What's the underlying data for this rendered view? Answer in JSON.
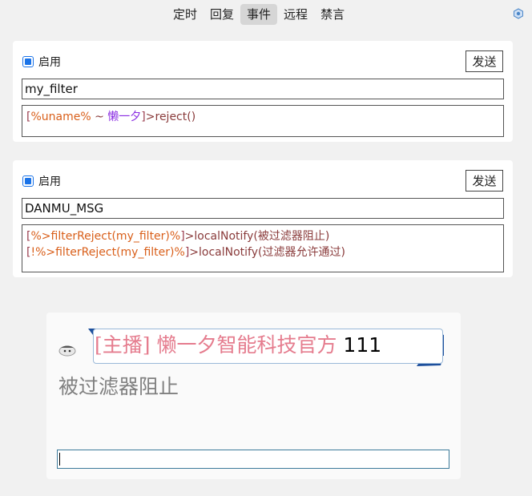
{
  "tabs": [
    {
      "label": "定时",
      "active": false
    },
    {
      "label": "回复",
      "active": false
    },
    {
      "label": "事件",
      "active": true
    },
    {
      "label": "远程",
      "active": false
    },
    {
      "label": "禁言",
      "active": false
    }
  ],
  "rules": [
    {
      "enabled": true,
      "enable_label": "启用",
      "send_label": "发送",
      "name": "my_filter",
      "code_lines": [
        [
          {
            "t": "[",
            "c": "brack"
          },
          {
            "t": "%uname%",
            "c": "orange"
          },
          {
            "t": " ~ ",
            "c": "plain"
          },
          {
            "t": "懒一夕",
            "c": "purple"
          },
          {
            "t": "]",
            "c": "brack"
          },
          {
            "t": ">reject()",
            "c": "plain"
          }
        ]
      ]
    },
    {
      "enabled": true,
      "enable_label": "启用",
      "send_label": "发送",
      "name": "DANMU_MSG",
      "code_lines": [
        [
          {
            "t": "[",
            "c": "brack"
          },
          {
            "t": "%>filterReject(my_filter)%",
            "c": "orange"
          },
          {
            "t": "]",
            "c": "brack"
          },
          {
            "t": ">localNotify(被过滤器阻止)",
            "c": "plain"
          }
        ],
        [
          {
            "t": "[",
            "c": "brack"
          },
          {
            "t": "!%>filterReject(my_filter)%",
            "c": "orange"
          },
          {
            "t": "]",
            "c": "brack"
          },
          {
            "t": ">localNotify(过滤器允许通过)",
            "c": "plain"
          }
        ]
      ]
    }
  ],
  "preview": {
    "danmu_name": "[主播] 懒一夕智能科技官方",
    "danmu_msg": "111",
    "result": "被过滤器阻止",
    "input_value": ""
  },
  "colors": {
    "accent": "#1a73e8",
    "orange": "#d95f1a",
    "purple": "#8a2be2",
    "name_pink": "#e57c8e"
  }
}
